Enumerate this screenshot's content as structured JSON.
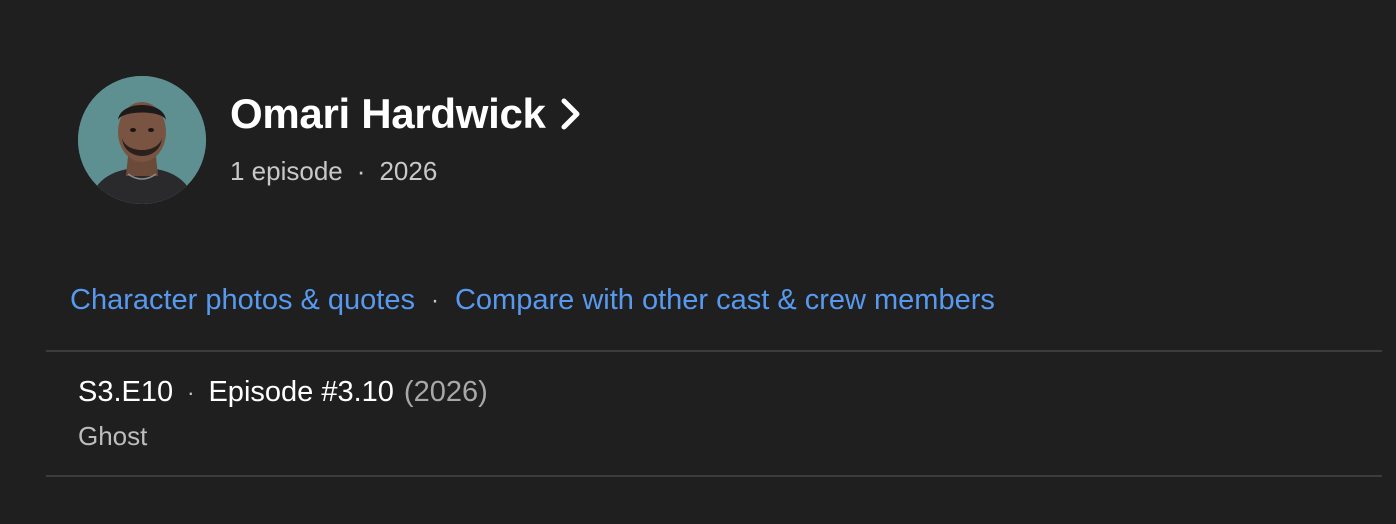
{
  "cast": {
    "name": "Omari Hardwick",
    "episodes": "1 episode",
    "separator": "·",
    "year": "2026"
  },
  "links": {
    "character": "Character photos & quotes",
    "separator": "·",
    "compare": "Compare with other cast & crew members"
  },
  "episode": {
    "code": "S3.E10",
    "separator": "·",
    "title": "Episode #3.10",
    "year": "(2026)",
    "character": "Ghost"
  },
  "colors": {
    "background": "#1f1f1f",
    "link": "#5799ef",
    "divider": "#3c3c3c"
  },
  "icons": {
    "name_arrow": "chevron-right-icon"
  }
}
